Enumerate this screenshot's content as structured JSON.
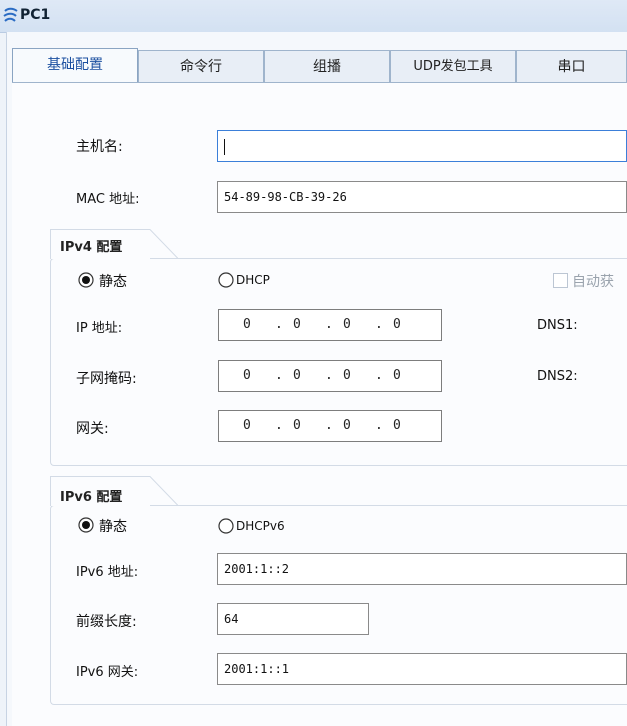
{
  "window": {
    "title": "PC1"
  },
  "tabs": [
    {
      "label": "基础配置",
      "active": true
    },
    {
      "label": "命令行",
      "active": false
    },
    {
      "label": "组播",
      "active": false
    },
    {
      "label": "UDP发包工具",
      "active": false
    },
    {
      "label": "串口",
      "active": false
    }
  ],
  "basic": {
    "hostname_label": "主机名:",
    "hostname_value": "",
    "mac_label": "MAC 地址:",
    "mac_value": "54-89-98-CB-39-26"
  },
  "ipv4": {
    "title": "IPv4 配置",
    "static_label": "静态",
    "dhcp_label": "DHCP",
    "mode": "static",
    "auto_dns_label": "自动获",
    "auto_dns_checked": false,
    "ip_label": "IP 地址:",
    "ip_value": [
      "0",
      "0",
      "0",
      "0"
    ],
    "mask_label": "子网掩码:",
    "mask_value": [
      "0",
      "0",
      "0",
      "0"
    ],
    "gateway_label": "网关:",
    "gateway_value": [
      "0",
      "0",
      "0",
      "0"
    ],
    "dns1_label": "DNS1:",
    "dns2_label": "DNS2:"
  },
  "ipv6": {
    "title": "IPv6 配置",
    "static_label": "静态",
    "dhcp_label": "DHCPv6",
    "mode": "static",
    "address_label": "IPv6 地址:",
    "address_value": "2001:1::2",
    "prefix_label": "前缀长度:",
    "prefix_value": "64",
    "gateway_label": "IPv6 网关:",
    "gateway_value": "2001:1::1"
  },
  "colors": {
    "accent": "#1b4fa0",
    "titlebar": "#d3e1f2",
    "focus_border": "#3b7fd9"
  }
}
